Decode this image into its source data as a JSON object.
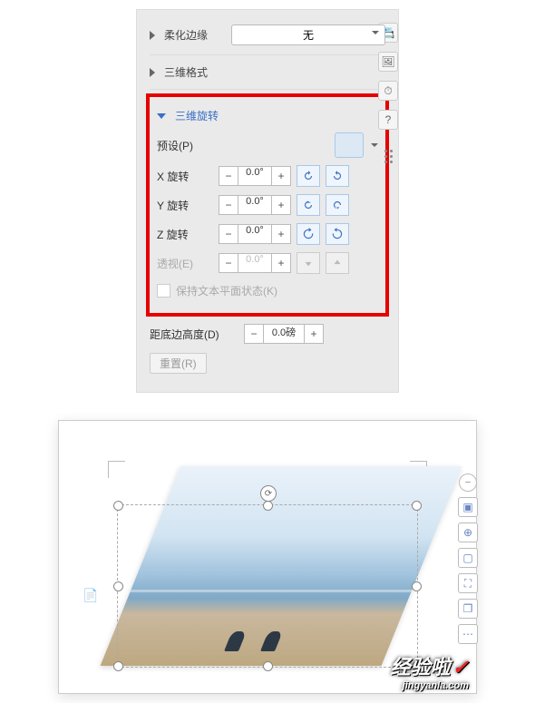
{
  "sections": {
    "soft_edges": "柔化边缘",
    "soft_value": "无",
    "threeD_format": "三维格式",
    "threeD_rotate": "三维旋转"
  },
  "preset": {
    "label": "预设(P)"
  },
  "rot": {
    "x_label": "X 旋转",
    "y_label": "Y 旋转",
    "z_label": "Z 旋转",
    "per_label": "透视(E)",
    "x_val": "0.0°",
    "y_val": "0.0°",
    "z_val": "0.0°",
    "per_val": "0.0°",
    "minus": "−",
    "plus": "+"
  },
  "keep_flat": "保持文本平面状态(K)",
  "distance": {
    "label": "距底边高度(D)",
    "val": "0.0磅"
  },
  "reset": "重置(R)",
  "side_icons": {
    "a": "📇",
    "b": "🖼",
    "c": "⏱",
    "d": "?"
  },
  "tools": {
    "minus": "−",
    "fit": "▣",
    "zoom": "⊕",
    "crop": "▢",
    "select": "⛶",
    "dup": "❐",
    "more": "⋯"
  },
  "doc_icon": "📄",
  "watermark": {
    "main": "经验啦",
    "check": "✓",
    "url": "jingyanla.com"
  }
}
